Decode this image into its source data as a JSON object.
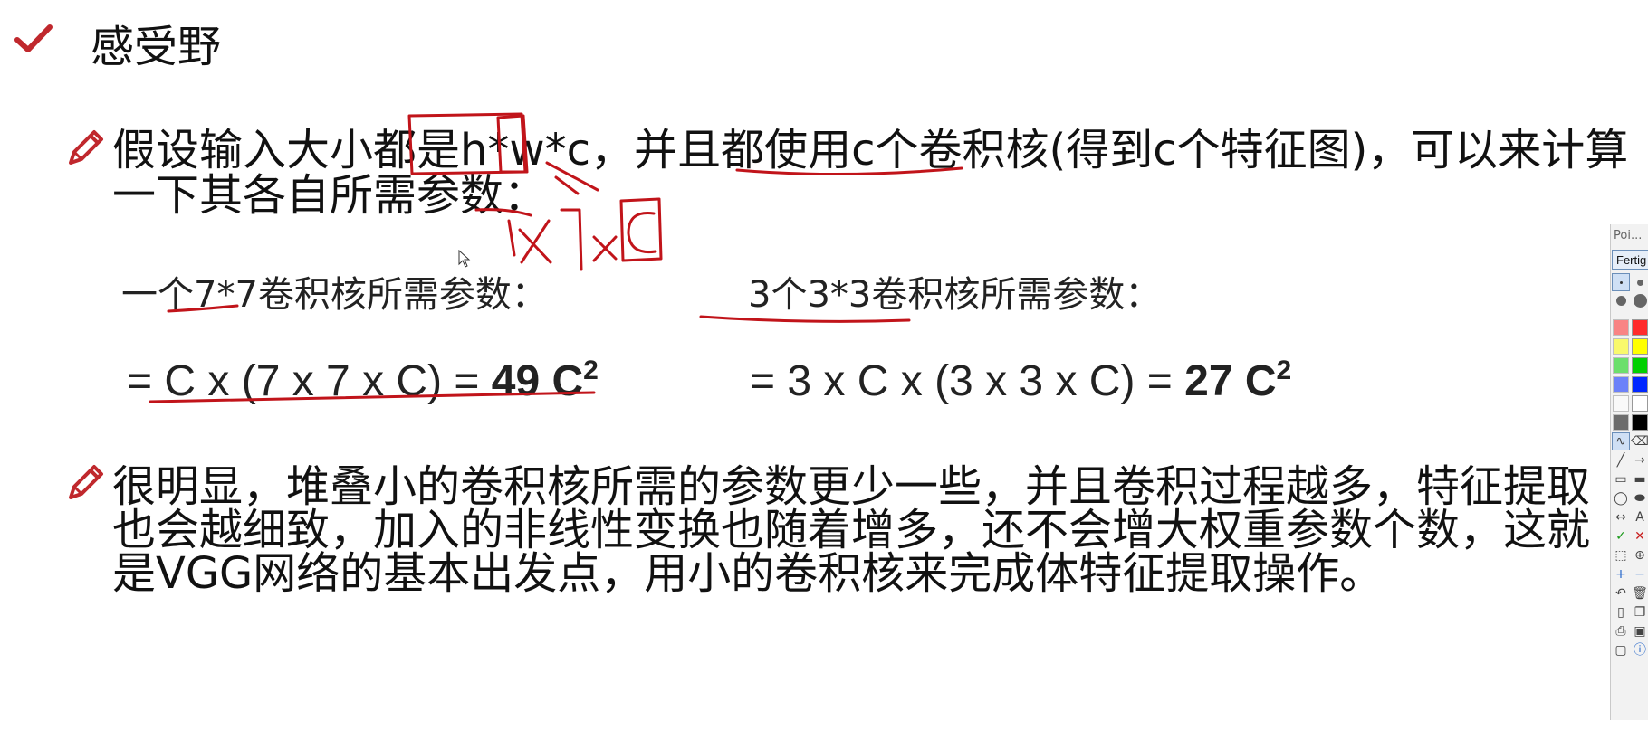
{
  "slide": {
    "title": "感受野",
    "para1": {
      "line1": "假设输入大小都是h*w*c，并且都使用c个卷积核(得到c个特征图)，可以来计算",
      "line2": "一下其各自所需参数："
    },
    "left_formula": {
      "label": "一个7*7卷积核所需参数：",
      "expr": "= C x (7 x 7 x C) = ",
      "result": "49 C",
      "exp": "2"
    },
    "right_formula": {
      "label": "3个3*3卷积核所需参数：",
      "expr": "= 3 x C x (3 x 3 x C) = ",
      "result": "27 C",
      "exp": "2"
    },
    "para2": {
      "line1": "很明显，堆叠小的卷积核所需的参数更少一些，并且卷积过程越多，特征提取",
      "line2": "也会越细致，加入的非线性变换也随着增多，还不会增大权重参数个数，这就",
      "line3": "是VGG网络的基本出发点，用小的卷积核来完成体特征提取操作。"
    },
    "annotation_text": "1x1xC"
  },
  "toolbar": {
    "title": "Poi...",
    "done_label": "Fertig",
    "swatches": [
      "#ff2b2b",
      "#ffff00",
      "#00d000",
      "#0026ff",
      "#ffffff",
      "#000000"
    ],
    "tools": [
      "pen-icon",
      "eraser-icon",
      "line-icon",
      "arrow-icon",
      "rect-icon",
      "filled-rect-icon",
      "ellipse-icon",
      "filled-ellipse-icon",
      "move-icon",
      "text-icon",
      "check-icon",
      "close-icon",
      "crop-icon",
      "zoom-icon",
      "plus-icon",
      "minus-icon",
      "undo-icon",
      "delete-icon",
      "new-icon",
      "copy-icon",
      "print-icon",
      "save-icon",
      "screen-icon",
      "info-icon"
    ]
  }
}
